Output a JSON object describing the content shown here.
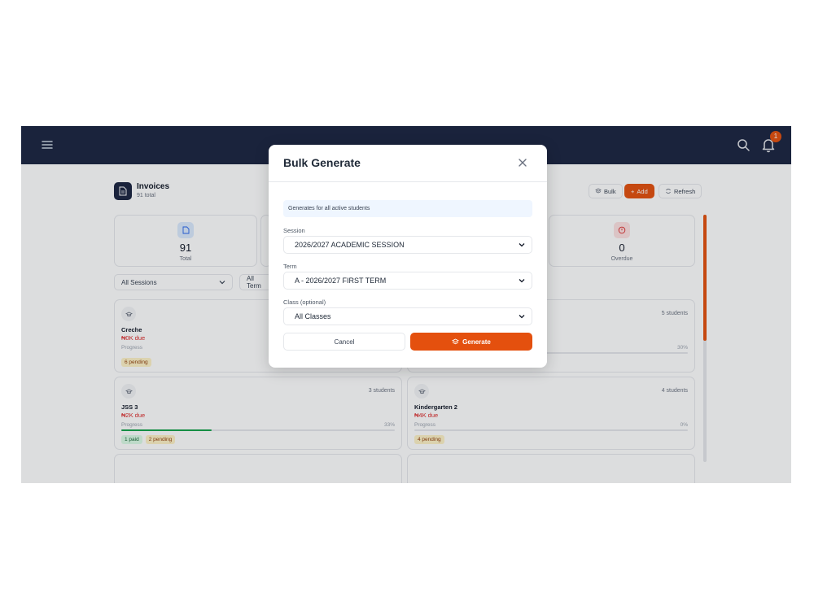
{
  "topbar": {
    "notification_count": "1"
  },
  "page": {
    "title": "Invoices",
    "subtitle": "91 total"
  },
  "actions": {
    "bulk": "Bulk",
    "add": "Add",
    "refresh": "Refresh"
  },
  "stats": [
    {
      "value": "91",
      "label": "Total"
    },
    {
      "value": "0",
      "label": "Overdue"
    }
  ],
  "filters": {
    "session": "All Sessions",
    "term": "All Term"
  },
  "cards": [
    {
      "students": "",
      "name": "Creche",
      "due": "₦0K due",
      "progress_label": "Progress",
      "percent": "",
      "tags": [
        {
          "text": "6 pending",
          "kind": "pending"
        }
      ]
    },
    {
      "students": "5 students",
      "name": "",
      "due": "",
      "progress_label": "",
      "percent": "30%",
      "tags": []
    },
    {
      "students": "3 students",
      "name": "JSS 3",
      "due": "₦2K due",
      "progress_label": "Progress",
      "percent": "33%",
      "tags": [
        {
          "text": "1 paid",
          "kind": "paid"
        },
        {
          "text": "2 pending",
          "kind": "pending"
        }
      ]
    },
    {
      "students": "4 students",
      "name": "Kindergarten 2",
      "due": "₦4K due",
      "progress_label": "Progress",
      "percent": "0%",
      "tags": [
        {
          "text": "4 pending",
          "kind": "pending"
        }
      ]
    }
  ],
  "card_progress": [
    0,
    0.3,
    0.33,
    0
  ],
  "modal": {
    "title": "Bulk Generate",
    "info": "Generates for all active students",
    "session_label": "Session",
    "session_value": "2026/2027 ACADEMIC SESSION",
    "term_label": "Term",
    "term_value": "A - 2026/2027 FIRST TERM",
    "class_label": "Class (optional)",
    "class_value": "All Classes",
    "cancel": "Cancel",
    "generate": "Generate"
  },
  "colors": {
    "navy": "#1c2541",
    "accent": "#e4500e"
  }
}
